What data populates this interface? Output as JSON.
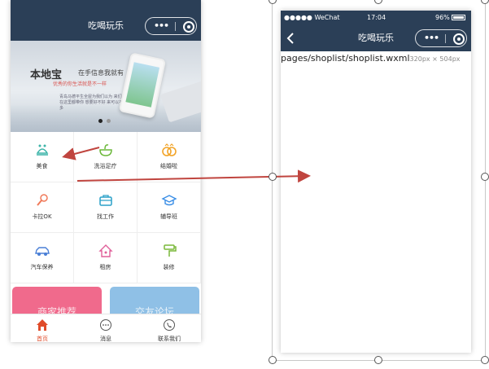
{
  "left_phone": {
    "nav_title": "吃喝玩乐",
    "banner": {
      "title": "本地宝",
      "title_small": "在手信息我就有",
      "subtitle": "优秀的你生活就是不一样",
      "note": "青岛马德平生全屋为我们以为 来们在这里都带你 想要好不好 来可以不多",
      "active_dot": 0
    },
    "grid": [
      {
        "label": "美食",
        "icon": "food-icon"
      },
      {
        "label": "洗浴足疗",
        "icon": "bath-icon"
      },
      {
        "label": "结婚啦",
        "icon": "wedding-rings-icon"
      },
      {
        "label": "卡拉OK",
        "icon": "microphone-icon"
      },
      {
        "label": "找工作",
        "icon": "briefcase-icon"
      },
      {
        "label": "辅导班",
        "icon": "graduation-cap-icon"
      },
      {
        "label": "汽车保养",
        "icon": "car-icon"
      },
      {
        "label": "租房",
        "icon": "house-icon"
      },
      {
        "label": "装修",
        "icon": "paint-roller-icon"
      }
    ],
    "cards": [
      {
        "label": "商家推荐",
        "color": "#f06a8c"
      },
      {
        "label": "交友论坛",
        "color": "#8fc0e6"
      }
    ],
    "tabs": [
      {
        "label": "首页",
        "icon": "home-icon",
        "active": true
      },
      {
        "label": "消息",
        "icon": "chat-icon",
        "active": false
      },
      {
        "label": "联系我们",
        "icon": "phone-icon",
        "active": false
      }
    ]
  },
  "right_phone": {
    "status": {
      "carrier": "●●●●● WeChat",
      "time": "17:04",
      "battery": "96%"
    },
    "nav_title": "吃喝玩乐",
    "page_path": "pages/shoplist/shoplist.wxml",
    "page_size": "320px × 504px"
  },
  "colors": {
    "nav_bg": "#2b3f57",
    "accent": "#e04b2a",
    "arrow": "#c0453f"
  }
}
